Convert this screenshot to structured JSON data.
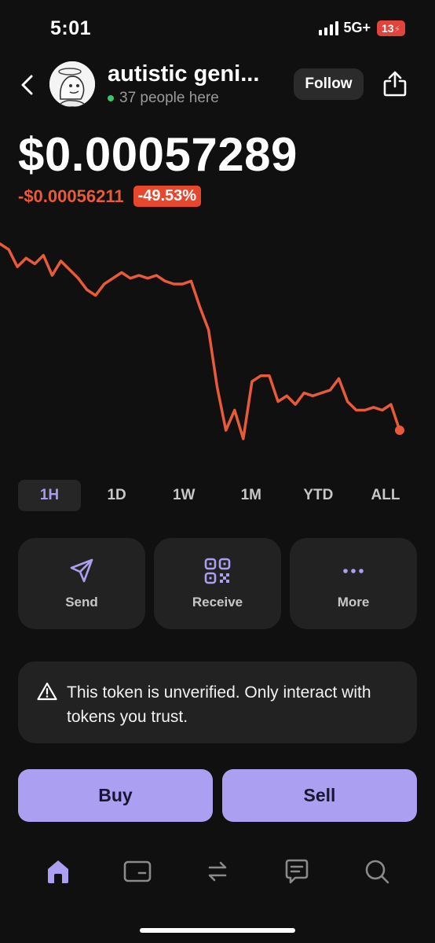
{
  "status_bar": {
    "time": "5:01",
    "network": "5G+",
    "battery": "13"
  },
  "header": {
    "token_name": "autistic geni...",
    "presence": "37 people here",
    "follow_label": "Follow"
  },
  "price": {
    "current": "$0.00057289",
    "change_abs": "-$0.00056211",
    "change_pct": "-49.53%"
  },
  "chart_data": {
    "type": "line",
    "series": [
      {
        "values": [
          100,
          98,
          92,
          95,
          93,
          96,
          89,
          94,
          91,
          88,
          84,
          82,
          86,
          88,
          90,
          88,
          89,
          88,
          89,
          87,
          86,
          86,
          87,
          78,
          70,
          50,
          35,
          42,
          32,
          52,
          54,
          54,
          45,
          47,
          44,
          48,
          47,
          48,
          49,
          53,
          45,
          42,
          42,
          43,
          42,
          44,
          35
        ]
      }
    ],
    "color": "#e85a38"
  },
  "timeframes": [
    {
      "label": "1H",
      "active": true
    },
    {
      "label": "1D",
      "active": false
    },
    {
      "label": "1W",
      "active": false
    },
    {
      "label": "1M",
      "active": false
    },
    {
      "label": "YTD",
      "active": false
    },
    {
      "label": "ALL",
      "active": false
    }
  ],
  "actions": {
    "send": "Send",
    "receive": "Receive",
    "more": "More"
  },
  "warning": {
    "text": "This token is unverified. Only interact with tokens you trust."
  },
  "trade": {
    "buy": "Buy",
    "sell": "Sell"
  },
  "tabbar": {
    "items": [
      "home-icon",
      "wallet-icon",
      "swap-icon",
      "chat-icon",
      "search-icon"
    ],
    "active": "home-icon"
  },
  "colors": {
    "accent": "#ab9ff2",
    "negative": "#e6472d",
    "background": "#101010",
    "card": "#222222"
  }
}
